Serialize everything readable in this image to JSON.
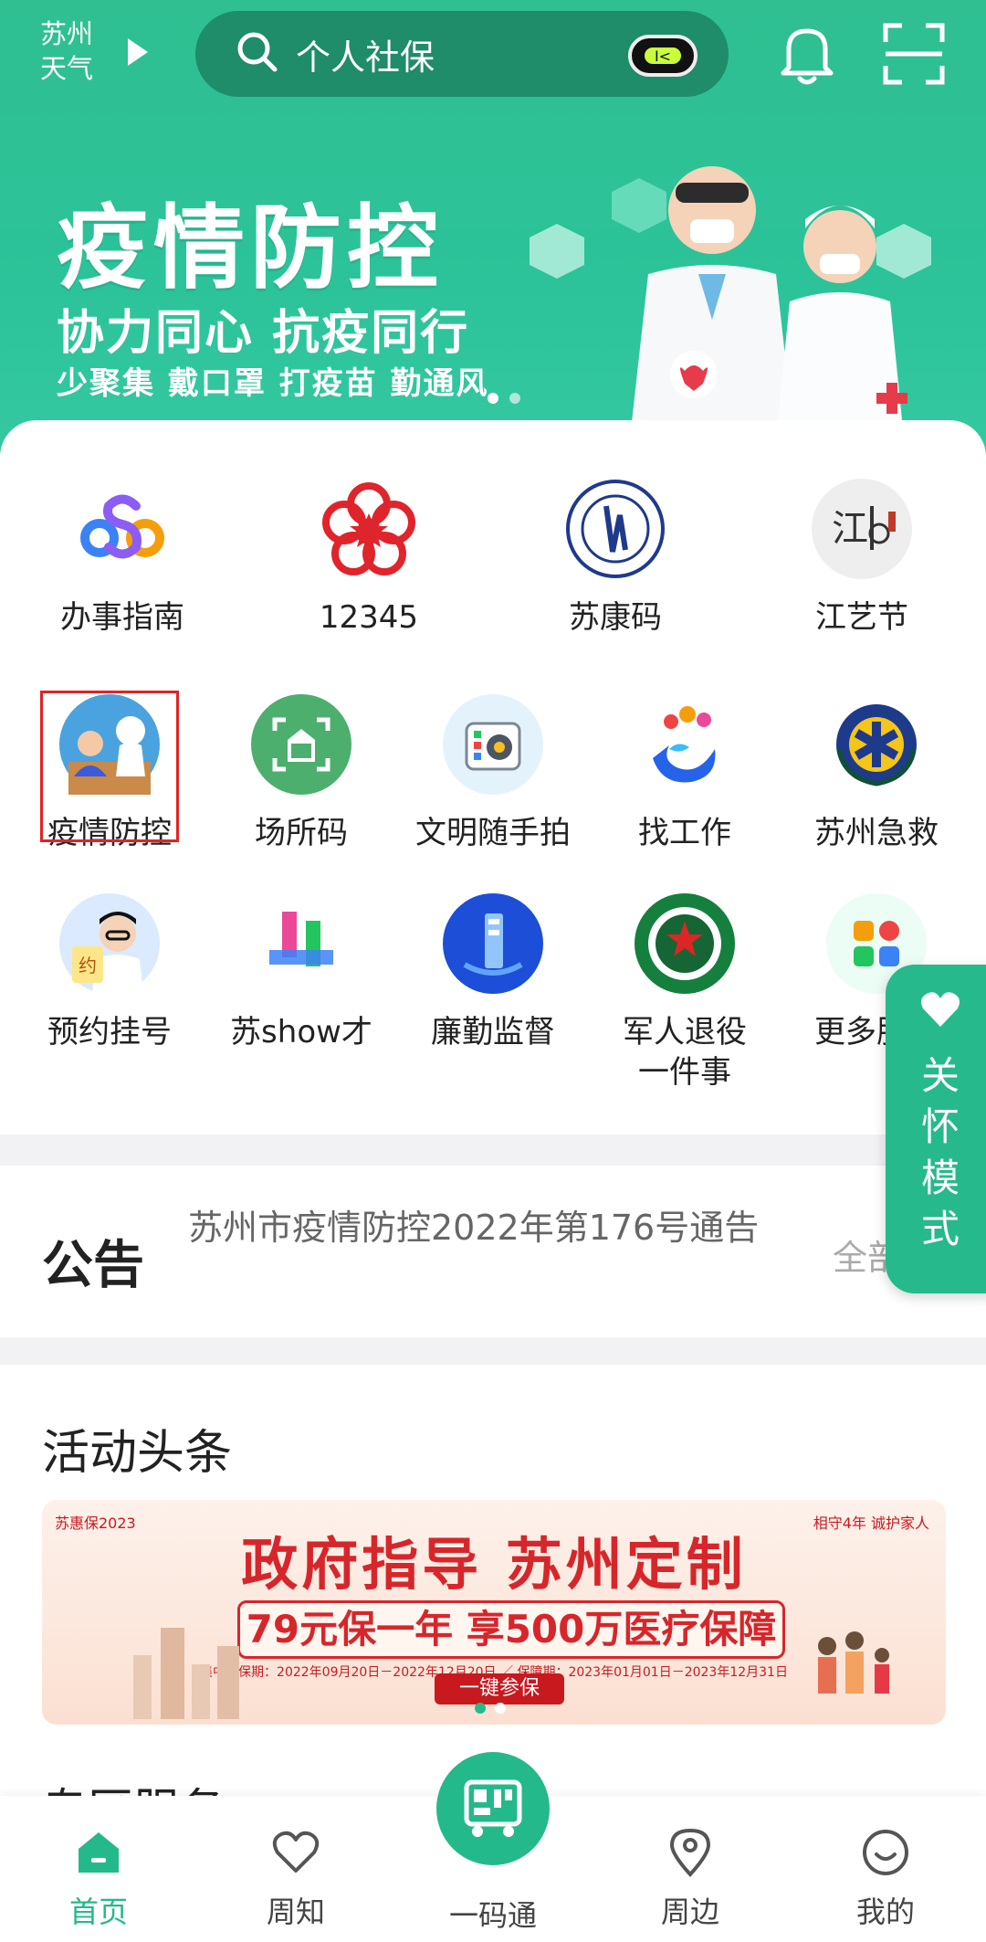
{
  "header": {
    "weather_line1": "苏州",
    "weather_line2": "天气",
    "search_text": "个人社保"
  },
  "banner": {
    "title": "疫情防控",
    "subtitle": "协力同心 抗疫同行",
    "slogan": "少聚集 戴口罩 打疫苗 勤通风"
  },
  "services": [
    {
      "label": "办事指南",
      "icon": "colorful-s-logo-icon"
    },
    {
      "label": "12345",
      "icon": "red-star-flower-icon"
    },
    {
      "label": "苏康码",
      "icon": "health-commission-seal-icon"
    },
    {
      "label": "江艺节",
      "icon": "art-festival-logo-icon"
    },
    {
      "label": "疫情防控",
      "icon": "nucleic-test-icon"
    },
    {
      "label": "场所码",
      "icon": "venue-code-icon"
    },
    {
      "label": "文明随手拍",
      "icon": "camera-icon"
    },
    {
      "label": "找工作",
      "icon": "job-swirl-icon"
    },
    {
      "label": "苏州急救",
      "icon": "emergency-star-of-life-icon"
    },
    {
      "label": "预约挂号",
      "icon": "doctor-appointment-icon"
    },
    {
      "label": "苏show才",
      "icon": "talent-logo-icon"
    },
    {
      "label": "廉勤监督",
      "icon": "supervision-icon"
    },
    {
      "label": "军人退役\n一件事",
      "icon": "veteran-emblem-icon"
    },
    {
      "label": "更多服务",
      "icon": "more-grid-icon"
    }
  ],
  "notice": {
    "heading": "公告",
    "text": "苏州市疫情防控2022年第176号通告",
    "all": "全部"
  },
  "care_mode": {
    "label": "关怀模式"
  },
  "activity": {
    "heading": "活动头条",
    "ad": {
      "logo": "苏惠保2023",
      "right": "相守4年 诚护家人",
      "title": "政府指导 苏州定制",
      "sub": "79元保一年 享500万医疗保障",
      "dates": "集中参保期：2022年09月20日－2022年12月20日 ／ 保障期：2023年01月01日－2023年12月31日",
      "button": "一键参保"
    }
  },
  "nearby_heading": "专区服务",
  "tabs": [
    {
      "label": "首页",
      "active": true
    },
    {
      "label": "周知",
      "active": false
    },
    {
      "label": "一码通",
      "active": false
    },
    {
      "label": "周边",
      "active": false
    },
    {
      "label": "我的",
      "active": false
    }
  ],
  "colors": {
    "brand": "#26b98c",
    "accent_red": "#d7262b"
  }
}
